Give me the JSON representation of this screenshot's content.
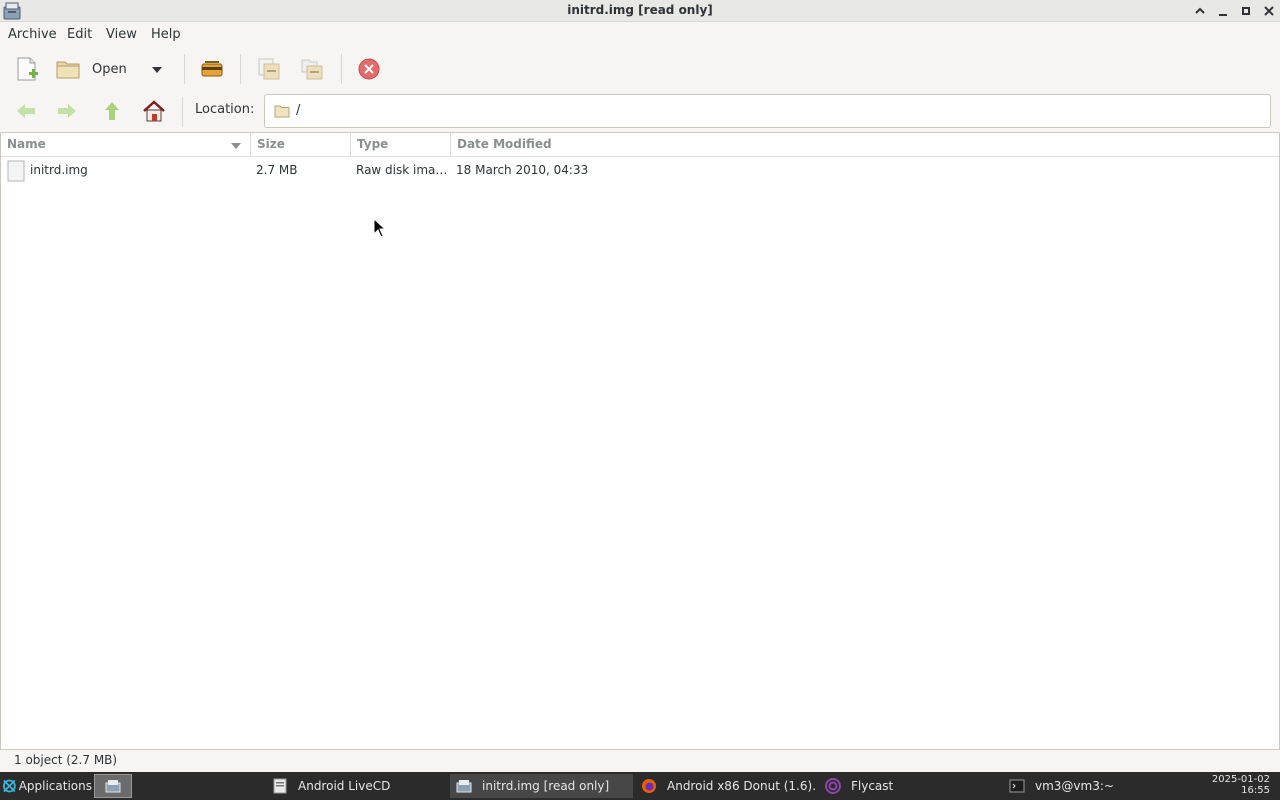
{
  "window": {
    "title": "initrd.img [read only]",
    "controls": [
      "maximize-icon",
      "minimize-icon",
      "restore-icon",
      "close-icon"
    ]
  },
  "menubar": {
    "items": [
      "Archive",
      "Edit",
      "View",
      "Help"
    ]
  },
  "toolbar": {
    "open_label": "Open",
    "icons": [
      "new-archive-icon",
      "open-folder-icon",
      "dropdown-arrow-icon",
      "extract-icon",
      "add-files-icon",
      "add-folder-icon",
      "stop-icon"
    ]
  },
  "location": {
    "label": "Location:",
    "path": "/",
    "nav_icons": [
      "back-arrow-icon",
      "forward-arrow-icon",
      "up-arrow-icon",
      "home-icon"
    ]
  },
  "filelist": {
    "columns": [
      "Name",
      "Size",
      "Type",
      "Date Modified"
    ],
    "sort_column": "Name",
    "rows": [
      {
        "name": "initrd.img",
        "size": "2.7 MB",
        "type": "Raw disk ima…",
        "date": "18 March 2010, 04:33"
      }
    ]
  },
  "statusbar": {
    "text": "1 object (2.7 MB)"
  },
  "taskbar": {
    "applications_label": "Applications",
    "tasks": [
      {
        "label": "Android LiveCD",
        "icon": "document-icon"
      },
      {
        "label": "initrd.img [read only]",
        "icon": "archive-icon",
        "active": true
      },
      {
        "label": "Android x86 Donut (1.6)…",
        "icon": "firefox-icon"
      },
      {
        "label": "Flycast",
        "icon": "flycast-icon"
      },
      {
        "label": "vm3@vm3:~",
        "icon": "terminal-icon"
      }
    ],
    "clock": {
      "date": "2025-01-02",
      "time": "16:55"
    }
  },
  "colors": {
    "window_bg": "#f6f5f4",
    "taskbar_bg": "#2b2b2b",
    "stop_red": "#e05a5a",
    "nav_green": "#8ac34a"
  }
}
